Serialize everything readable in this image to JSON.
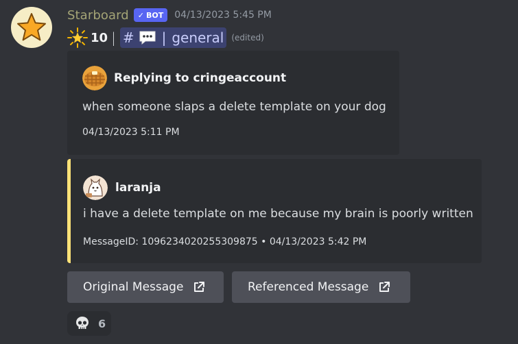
{
  "message": {
    "username": "Starboard",
    "bot_badge": "BOT",
    "timestamp": "04/13/2023 5:45 PM",
    "avatar_icon": "star-icon",
    "star_count": "10",
    "separator": "|",
    "channel": {
      "hash": "#",
      "icon": "speech-bubble-icon",
      "bar": "|",
      "name": "general"
    },
    "edited_label": "(edited)"
  },
  "reply_embed": {
    "author_prefix": "Replying to cringeaccount",
    "author_icon": "waffle-avatar",
    "text": "when someone slaps a delete template on your dog",
    "footer": "04/13/2023 5:11 PM"
  },
  "original_embed": {
    "author": "laranja",
    "author_icon": "cat-avatar",
    "text": "i have a delete template on me because my brain is poorly written",
    "footer": "MessageID: 1096234020255309875 • 04/13/2023 5:42 PM",
    "accent_color": "#ffe278"
  },
  "buttons": [
    {
      "label": "Original Message",
      "icon": "external-link-icon"
    },
    {
      "label": "Referenced Message",
      "icon": "external-link-icon"
    }
  ],
  "reaction": {
    "emoji": "skull-icon",
    "count": "6"
  },
  "colors": {
    "background": "#313338",
    "embed_bg": "#2b2d31",
    "blurple": "#5865f2",
    "username": "#a4a476",
    "button_bg": "#4e5058"
  }
}
